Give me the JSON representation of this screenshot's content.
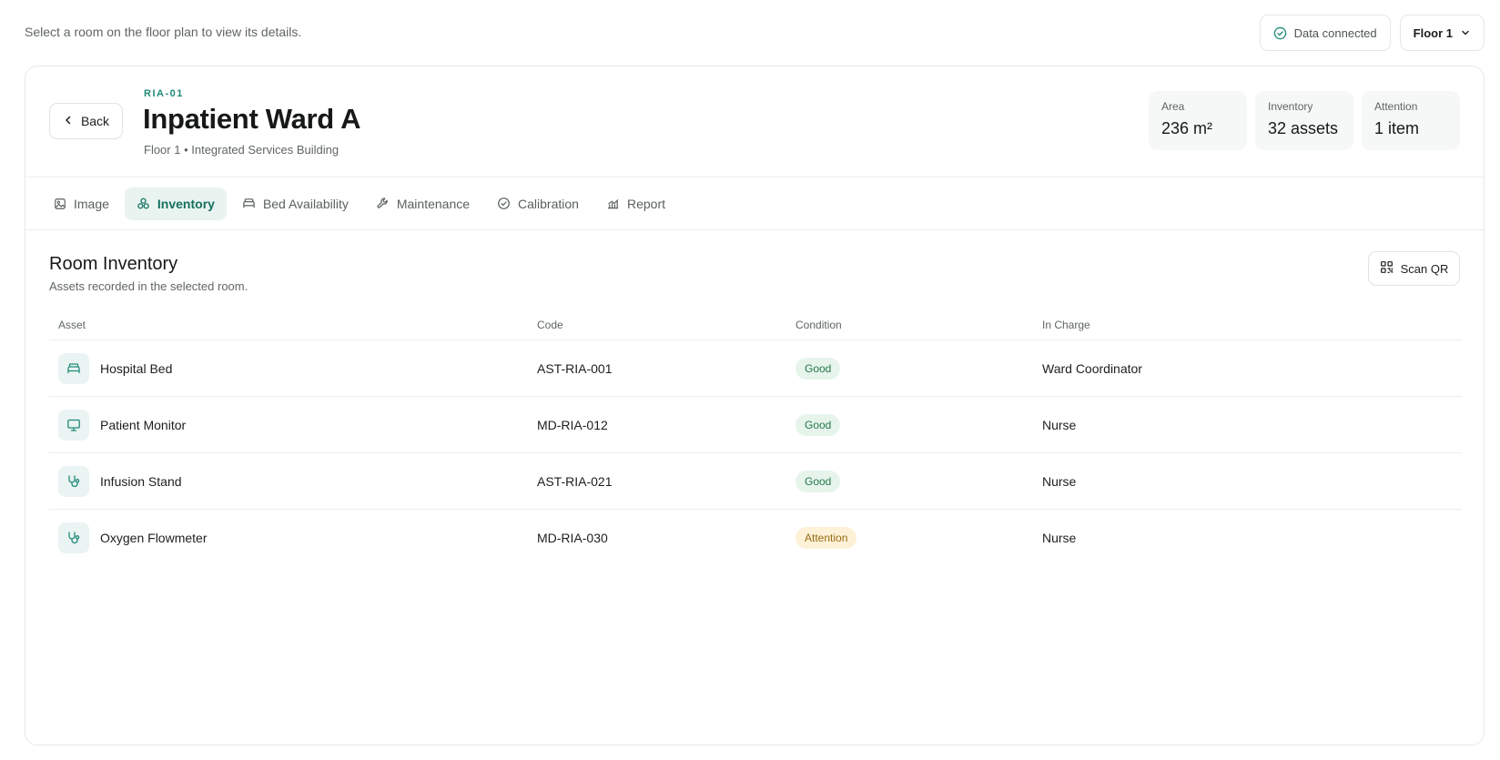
{
  "topbar": {
    "hint": "Select a room on the floor plan to view its details.",
    "status_label": "Data connected",
    "floor_selected": "Floor 1"
  },
  "room": {
    "back_label": "Back",
    "code": "RIA-01",
    "title": "Inpatient Ward A",
    "subtitle": "Floor 1 • Integrated Services Building",
    "stats": [
      {
        "label": "Area",
        "value": "236 m²"
      },
      {
        "label": "Inventory",
        "value": "32 assets"
      },
      {
        "label": "Attention",
        "value": "1 item"
      }
    ]
  },
  "tabs": [
    {
      "label": "Image",
      "icon": "image-icon"
    },
    {
      "label": "Inventory",
      "icon": "boxes-icon",
      "active": true
    },
    {
      "label": "Bed Availability",
      "icon": "bed-icon"
    },
    {
      "label": "Maintenance",
      "icon": "wrench-icon"
    },
    {
      "label": "Calibration",
      "icon": "check-circle-icon"
    },
    {
      "label": "Report",
      "icon": "chart-icon"
    }
  ],
  "inventory": {
    "title": "Room Inventory",
    "subtitle": "Assets recorded in the selected room.",
    "scan_label": "Scan QR",
    "columns": [
      "Asset",
      "Code",
      "Condition",
      "In Charge"
    ],
    "rows": [
      {
        "asset": "Hospital Bed",
        "icon": "bed-icon",
        "code": "AST-RIA-001",
        "condition": "Good",
        "in_charge": "Ward Coordinator"
      },
      {
        "asset": "Patient Monitor",
        "icon": "monitor-icon",
        "code": "MD-RIA-012",
        "condition": "Good",
        "in_charge": "Nurse"
      },
      {
        "asset": "Infusion Stand",
        "icon": "stethoscope-icon",
        "code": "AST-RIA-021",
        "condition": "Good",
        "in_charge": "Nurse"
      },
      {
        "asset": "Oxygen Flowmeter",
        "icon": "stethoscope-icon",
        "code": "MD-RIA-030",
        "condition": "Attention",
        "in_charge": "Nurse"
      }
    ]
  },
  "colors": {
    "accent": "#1f8a78",
    "accent_bg": "#e9f4f1",
    "good_bg": "#e7f4ec",
    "good_text": "#23794a",
    "attention_bg": "#fdf2d8",
    "attention_text": "#9a6a12"
  }
}
